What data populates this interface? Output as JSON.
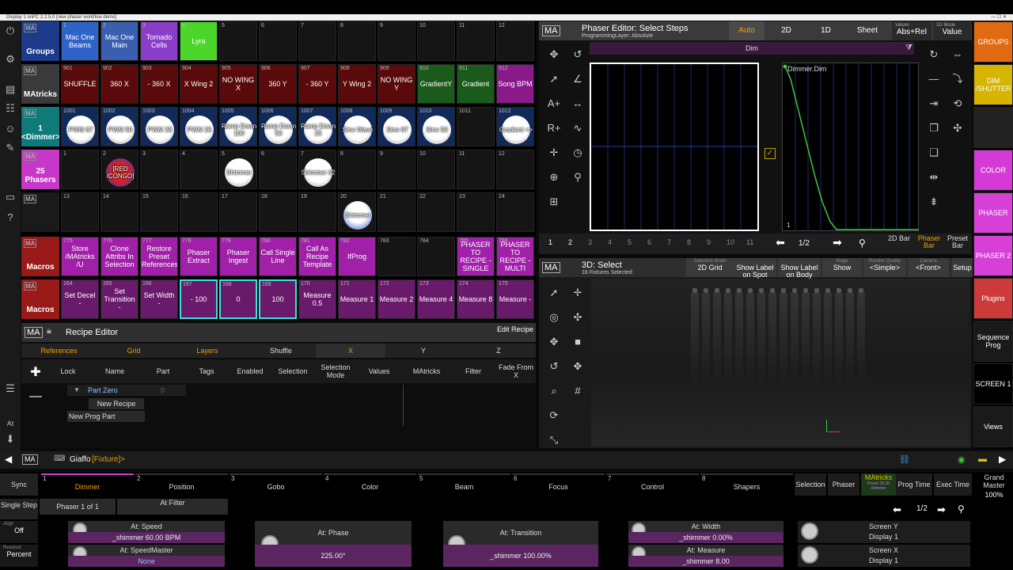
{
  "window": {
    "title": "Display 1 onPC 2.2.5.0 [new phaser workflow demo]"
  },
  "groups_row": {
    "name": "Groups",
    "cells": [
      {
        "num": "1",
        "label": "Mac One Beams",
        "color": "#2f63c8"
      },
      {
        "num": "2",
        "label": "Mac One Main",
        "color": "#3a5fb0"
      },
      {
        "num": "3",
        "label": "Tornado Cells",
        "color": "#8a3ec8"
      },
      {
        "num": "4",
        "label": "Lyra",
        "color": "#4cd62a"
      },
      {
        "num": "5",
        "label": ""
      },
      {
        "num": "6",
        "label": ""
      },
      {
        "num": "7",
        "label": ""
      },
      {
        "num": "8",
        "label": ""
      },
      {
        "num": "9",
        "label": ""
      },
      {
        "num": "10",
        "label": ""
      },
      {
        "num": "11",
        "label": ""
      },
      {
        "num": "12",
        "label": ""
      }
    ]
  },
  "matricks_row": {
    "name": "MAtricks",
    "cells": [
      {
        "num": "901",
        "label": "SHUFFLE"
      },
      {
        "num": "902",
        "label": "360 X"
      },
      {
        "num": "903",
        "label": "- 360 X"
      },
      {
        "num": "904",
        "label": "X Wing 2"
      },
      {
        "num": "905",
        "label": "NO WING X"
      },
      {
        "num": "906",
        "label": "360 Y"
      },
      {
        "num": "907",
        "label": "- 360 Y"
      },
      {
        "num": "908",
        "label": "Y Wing 2"
      },
      {
        "num": "909",
        "label": "NO WING Y"
      },
      {
        "num": "910",
        "label": "GradientY"
      },
      {
        "num": "911",
        "label": "Gradient"
      },
      {
        "num": "912",
        "label": "Song BPM"
      }
    ]
  },
  "dimmer_row": {
    "name": "1 <Dimmer>",
    "cells": [
      {
        "num": "1001",
        "label": "PWM 67"
      },
      {
        "num": "1002",
        "label": "PWM 50"
      },
      {
        "num": "1003",
        "label": "PWM 33"
      },
      {
        "num": "1004",
        "label": "PWM 25"
      },
      {
        "num": "1005",
        "label": "Ramp Down 100"
      },
      {
        "num": "1006",
        "label": "Ramp Down 50"
      },
      {
        "num": "1007",
        "label": "Ramp Down 25"
      },
      {
        "num": "1008",
        "label": "Sine Wave"
      },
      {
        "num": "1009",
        "label": "Sine 67"
      },
      {
        "num": "1010",
        "label": "Sine 50"
      },
      {
        "num": "1011",
        "label": ""
      },
      {
        "num": "1012",
        "label": "Gradient <>"
      }
    ]
  },
  "phasers_row": {
    "name": "25 Phasers",
    "cells": [
      {
        "num": "1",
        "label": ""
      },
      {
        "num": "2",
        "label": "[RED /CONGO]"
      },
      {
        "num": "3",
        "label": ""
      },
      {
        "num": "4",
        "label": ""
      },
      {
        "num": "5",
        "label": "Shimmer"
      },
      {
        "num": "6",
        "label": ""
      },
      {
        "num": "7",
        "label": "Shimmer #2"
      },
      {
        "num": "8",
        "label": ""
      },
      {
        "num": "9",
        "label": ""
      },
      {
        "num": "10",
        "label": ""
      },
      {
        "num": "11",
        "label": ""
      },
      {
        "num": "12",
        "label": ""
      }
    ]
  },
  "phasers_row2": {
    "cells": [
      {
        "num": "13",
        "label": ""
      },
      {
        "num": "14",
        "label": ""
      },
      {
        "num": "15",
        "label": ""
      },
      {
        "num": "16",
        "label": ""
      },
      {
        "num": "17",
        "label": ""
      },
      {
        "num": "18",
        "label": ""
      },
      {
        "num": "19",
        "label": ""
      },
      {
        "num": "20",
        "label": "Shimmer"
      },
      {
        "num": "21",
        "label": ""
      },
      {
        "num": "22",
        "label": ""
      },
      {
        "num": "23",
        "label": ""
      },
      {
        "num": "24",
        "label": ""
      }
    ]
  },
  "macros_row": {
    "name": "Macros",
    "cells": [
      {
        "num": "775",
        "label": "Store /MAtricks /U"
      },
      {
        "num": "776",
        "label": "Clone Attribs In Selection"
      },
      {
        "num": "777",
        "label": "Restore Preset References"
      },
      {
        "num": "778",
        "label": "Phaser Extract"
      },
      {
        "num": "779",
        "label": "Phaser Ingest"
      },
      {
        "num": "780",
        "label": "Call Single Line"
      },
      {
        "num": "781",
        "label": "Call As Recipe Template"
      },
      {
        "num": "782",
        "label": "IfProg"
      },
      {
        "num": "783",
        "label": ""
      },
      {
        "num": "784",
        "label": ""
      },
      {
        "num": "785",
        "label": "PHASER TO RECIPE - SINGLE"
      },
      {
        "num": "786",
        "label": "PHASER TO RECIPE - MULTI"
      }
    ]
  },
  "macros_row2": {
    "name": "Macros",
    "cells": [
      {
        "num": "164",
        "label": "Set Decel -"
      },
      {
        "num": "165",
        "label": "Set Transition -"
      },
      {
        "num": "166",
        "label": "Set Width -"
      },
      {
        "num": "167",
        "label": "- 100"
      },
      {
        "num": "168",
        "label": "0"
      },
      {
        "num": "169",
        "label": "100"
      },
      {
        "num": "170",
        "label": "Measure 0.5"
      },
      {
        "num": "171",
        "label": "Measure 1"
      },
      {
        "num": "172",
        "label": "Measure 2"
      },
      {
        "num": "173",
        "label": "Measure 4"
      },
      {
        "num": "174",
        "label": "Measure 8"
      },
      {
        "num": "175",
        "label": "Measure -"
      }
    ]
  },
  "phaser_editor": {
    "title": "Phaser Editor: Select Steps",
    "subtitle": "ProgrammingLayer: Absolute",
    "tabs": [
      "Auto",
      "2D",
      "1D",
      "Sheet"
    ],
    "values_label": "Values",
    "values_value": "Abs+Rel",
    "mode_label": "1D Mode",
    "mode_value": "Value",
    "channel": "Dim",
    "graph_label": "Dimmer.Dim",
    "graph_step": "1",
    "steps": [
      "1",
      "2",
      "3",
      "4",
      "5",
      "6",
      "7",
      "8",
      "9",
      "10",
      "11"
    ],
    "page": "1/2",
    "bottom_buttons": [
      "2D Bar",
      "Phaser Bar",
      "Preset Bar"
    ]
  },
  "view3d": {
    "title": "3D: Select",
    "subtitle": "16 Fixtures Selected",
    "controls": [
      {
        "label": "Selection Mode",
        "value": "2D Grid"
      },
      {
        "label": "",
        "value": "Show Label on Spot"
      },
      {
        "label": "",
        "value": "Show Label on Body"
      },
      {
        "label": "Stage",
        "value": "Show"
      },
      {
        "label": "Render Quality",
        "value": "<Simple>"
      },
      {
        "label": "Camera",
        "value": "<Front>"
      },
      {
        "label": "",
        "value": "Setup"
      }
    ]
  },
  "rightbar": [
    {
      "label": "GROUPS",
      "color": "#e06a12"
    },
    {
      "label": "DIM /SHUTTER",
      "color": "#d6b400"
    },
    {
      "label": "",
      "color": "#222"
    },
    {
      "label": "COLOR",
      "color": "#d63ad6"
    },
    {
      "label": "PHASER",
      "color": "#d640d6"
    },
    {
      "label": "PHASER 2",
      "color": "#d640d6"
    },
    {
      "label": "Plugins",
      "color": "#cc3a3a"
    },
    {
      "label": "Sequence Prog",
      "color": "#1a1a1a"
    },
    {
      "label": "SCREEN 1",
      "color": "#000"
    },
    {
      "label": "Views",
      "color": "#1a1a1a"
    }
  ],
  "recipe_editor": {
    "title": "Recipe Editor",
    "edit_button": "Edit Recipe",
    "tabs": [
      "References",
      "Grid",
      "Layers",
      "Shuffle",
      "X",
      "Y",
      "Z"
    ],
    "columns": [
      "Lock",
      "Name",
      "Part",
      "Tags",
      "Enabled",
      "Selection",
      "Selection Mode",
      "Values",
      "MAtricks",
      "Filter",
      "Fade From X"
    ],
    "part_name": "Part Zero",
    "part_num": "0",
    "new_recipe": "New Recipe",
    "new_prog_part": "New Prog Part"
  },
  "command_line": {
    "text": "Giaffo",
    "fixture": "[Fixture]>"
  },
  "encoder_bar": {
    "sync": "Sync",
    "features": [
      {
        "num": "1",
        "name": "Dimmer"
      },
      {
        "num": "2",
        "name": "Position"
      },
      {
        "num": "3",
        "name": "Gobo"
      },
      {
        "num": "4",
        "name": "Color"
      },
      {
        "num": "5",
        "name": "Beam"
      },
      {
        "num": "6",
        "name": "Focus"
      },
      {
        "num": "7",
        "name": "Control"
      },
      {
        "num": "8",
        "name": "Shapers"
      }
    ],
    "right_tabs": [
      "Selection",
      "Phaser",
      "MAtricks",
      "Prog Time",
      "Exec Time"
    ],
    "matricks_sub": "Preset 25.20 shimmer",
    "grand_master": "Grand Master",
    "grand_value": "100%",
    "single_step": "Single Step",
    "phaser_count": "Phaser 1 of 1",
    "at_filter": "At Filter",
    "align_label": "Align",
    "align_value": "Off",
    "readout_label": "Readout",
    "readout_value": "Percent",
    "page": "1/2",
    "encoders": [
      {
        "title": "At: Speed",
        "value": "_shimmer  60.00  BPM"
      },
      {
        "title": "At: SpeedMaster",
        "value": "None"
      },
      {
        "title": "At: Phase",
        "value": "225.00°"
      },
      {
        "title": "At: Transition",
        "value": "_shimmer  100.00%"
      },
      {
        "title": "At: Width",
        "value": "_shimmer  0.00%"
      },
      {
        "title": "At: Measure",
        "value": "_shimmer  8.00"
      }
    ],
    "screen": [
      {
        "title": "Screen Y",
        "value": "Display 1"
      },
      {
        "title": "Screen X",
        "value": "Display 1"
      }
    ]
  }
}
